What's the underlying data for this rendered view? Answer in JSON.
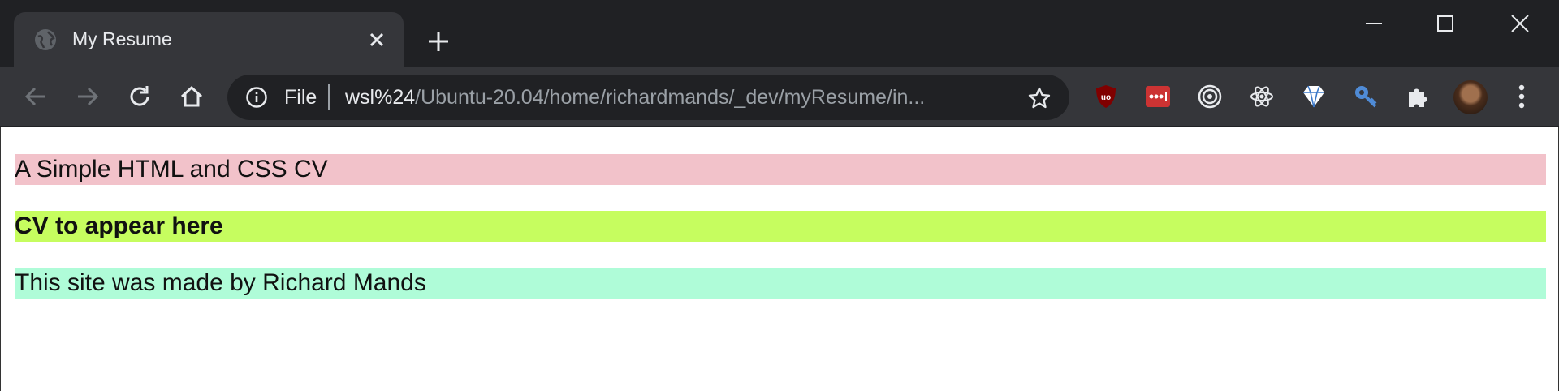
{
  "browser": {
    "tab": {
      "title": "My Resume",
      "favicon": "globe-icon"
    },
    "omnibox": {
      "scheme_label": "File",
      "url_host": "wsl%24",
      "url_path": "/Ubuntu-20.04/home/richardmands/_dev/myResume/in..."
    },
    "extensions": [
      "ublock-origin-icon",
      "lastpass-icon",
      "target-icon",
      "react-devtools-icon",
      "diamond-icon",
      "key-icon",
      "puzzle-icon"
    ]
  },
  "page": {
    "header": {
      "text": "A Simple HTML and CSS CV",
      "bg": "#f2c2ca"
    },
    "main": {
      "text": "CV to appear here",
      "bg": "#c6fd5f"
    },
    "footer": {
      "text": "This site was made by Richard Mands",
      "bg": "#affcd8"
    }
  },
  "colors": {
    "titlebar": "#202124",
    "toolbar": "#35363a",
    "ublock": "#800000",
    "lastpass": "#cc3333",
    "react": "#e8eaed",
    "key": "#4f8bd6"
  }
}
